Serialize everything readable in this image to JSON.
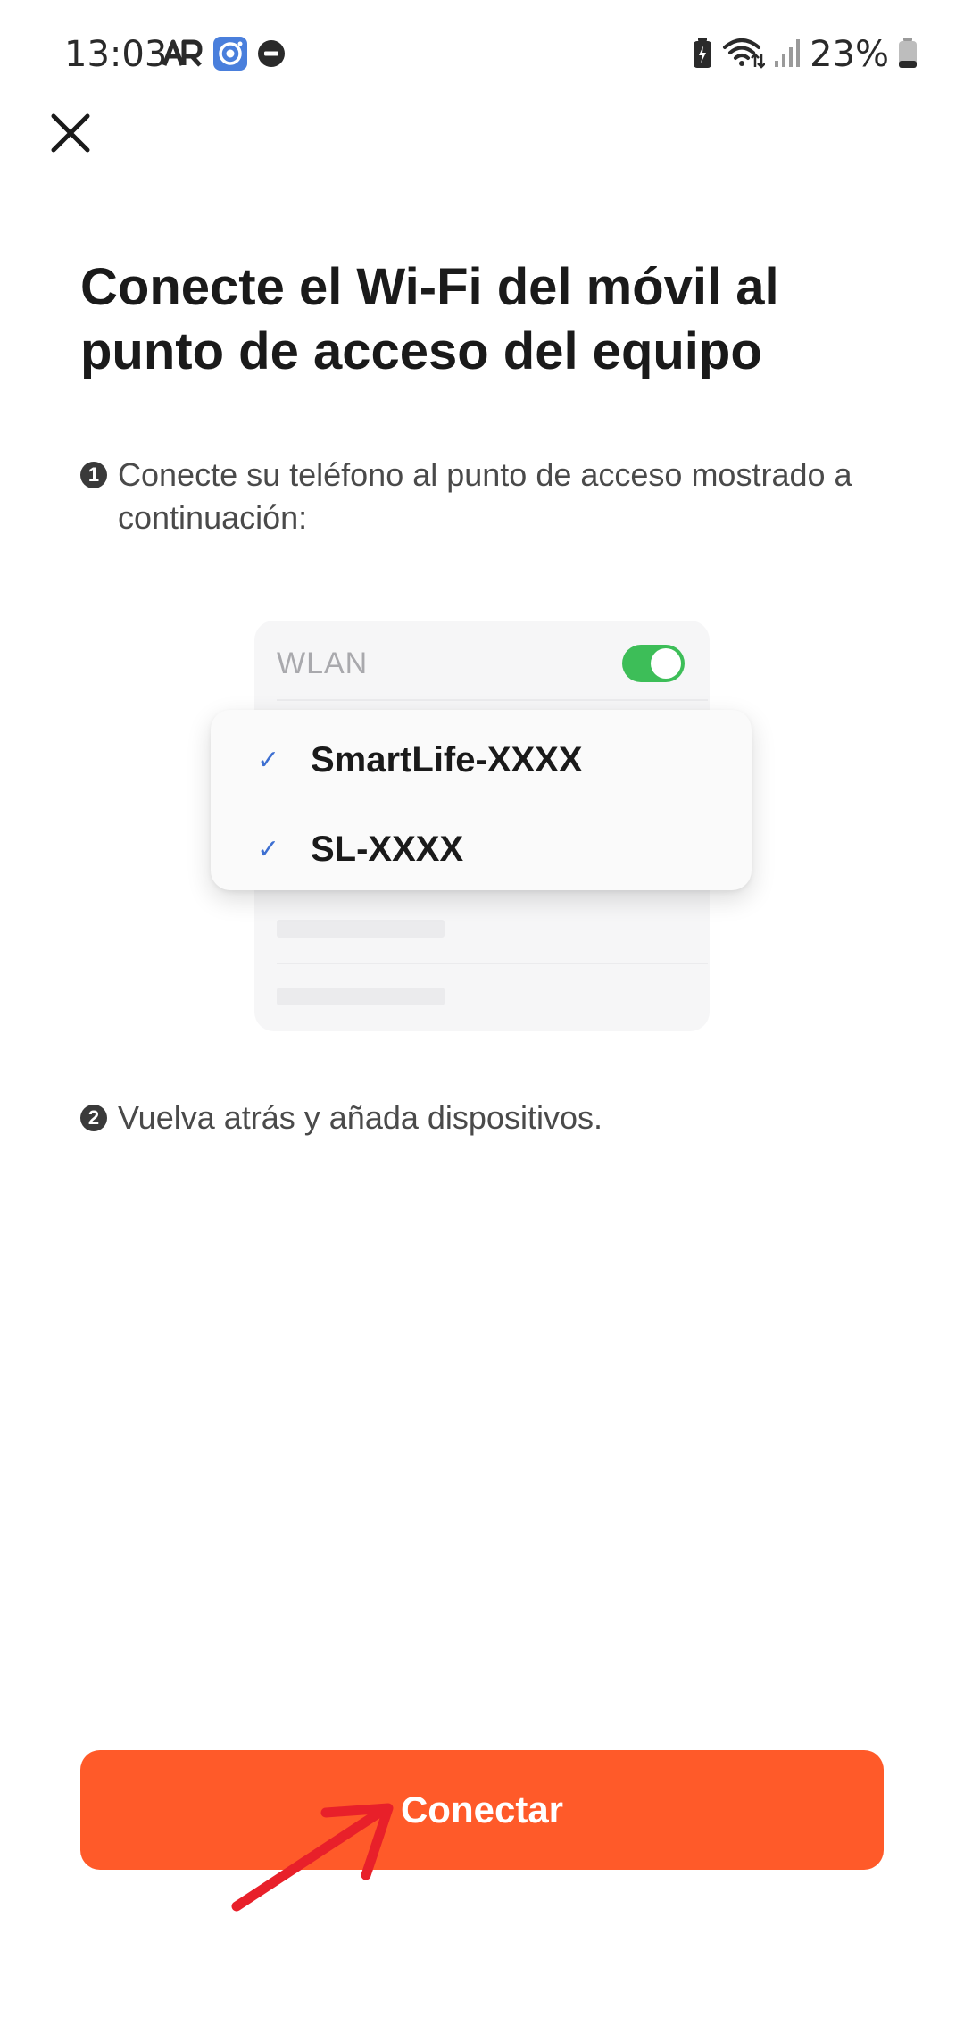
{
  "status_bar": {
    "time": "13:03",
    "battery_percent": "23%",
    "icons": [
      "ar-icon",
      "camera-app-icon",
      "do-not-disturb-icon",
      "battery-saver-icon",
      "wifi-data-icon",
      "signal-bars-icon",
      "battery-icon"
    ]
  },
  "header": {
    "close_icon": "close-icon"
  },
  "main": {
    "title": "Conecte el Wi-Fi del móvil al punto de acceso del equipo",
    "steps": [
      {
        "number": "1",
        "text": "Conecte su teléfono al punto de acceso mostrado a continuación:"
      },
      {
        "number": "2",
        "text": "Vuelva atrás y añada dispositivos."
      }
    ]
  },
  "illustration": {
    "wlan_label": "WLAN",
    "wlan_enabled": true,
    "networks": [
      {
        "check": "✓",
        "name": "SmartLife-XXXX"
      },
      {
        "check": "✓",
        "name": "SL-XXXX"
      }
    ]
  },
  "footer": {
    "connect_label": "Conectar"
  },
  "colors": {
    "accent": "#ff5a29",
    "toggle_on": "#3dbe58",
    "check": "#3d6fd1",
    "annotation_arrow": "#e8202a"
  }
}
